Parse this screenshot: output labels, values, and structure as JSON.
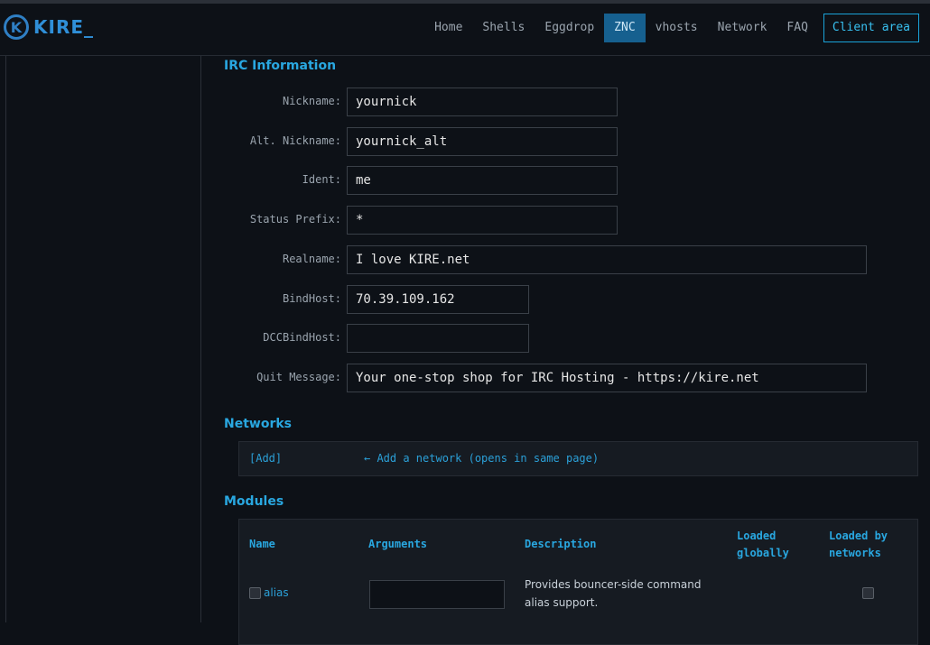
{
  "brand": {
    "logo_letter": "K",
    "logo_text": "KIRE_"
  },
  "nav": {
    "items": [
      "Home",
      "Shells",
      "Eggdrop",
      "ZNC",
      "vhosts",
      "Network",
      "FAQ"
    ],
    "active": "ZNC",
    "client_area": "Client area"
  },
  "irc": {
    "title": "IRC Information",
    "nickname_label": "Nickname:",
    "nickname": "yournick",
    "altnick_label": "Alt. Nickname:",
    "altnick": "yournick_alt",
    "ident_label": "Ident:",
    "ident": "me",
    "prefix_label": "Status Prefix:",
    "prefix": "*",
    "realname_label": "Realname:",
    "realname": "I love KIRE.net",
    "bindhost_label": "BindHost:",
    "bindhost": "70.39.109.162",
    "dccbindhost_label": "DCCBindHost:",
    "dccbindhost": "",
    "quit_label": "Quit Message:",
    "quit": "Your one-stop shop for IRC Hosting - https://kire.net"
  },
  "networks": {
    "title": "Networks",
    "add_link": "[Add]",
    "add_hint": "← Add a network (opens in same page)"
  },
  "modules": {
    "title": "Modules",
    "headers": {
      "name": "Name",
      "arguments": "Arguments",
      "description": "Description",
      "loaded_globally": "Loaded globally",
      "loaded_by_networks": "Loaded by networks"
    },
    "rows": [
      {
        "name": "alias",
        "arguments": "",
        "description": "Provides bouncer-side command alias support."
      }
    ]
  }
}
